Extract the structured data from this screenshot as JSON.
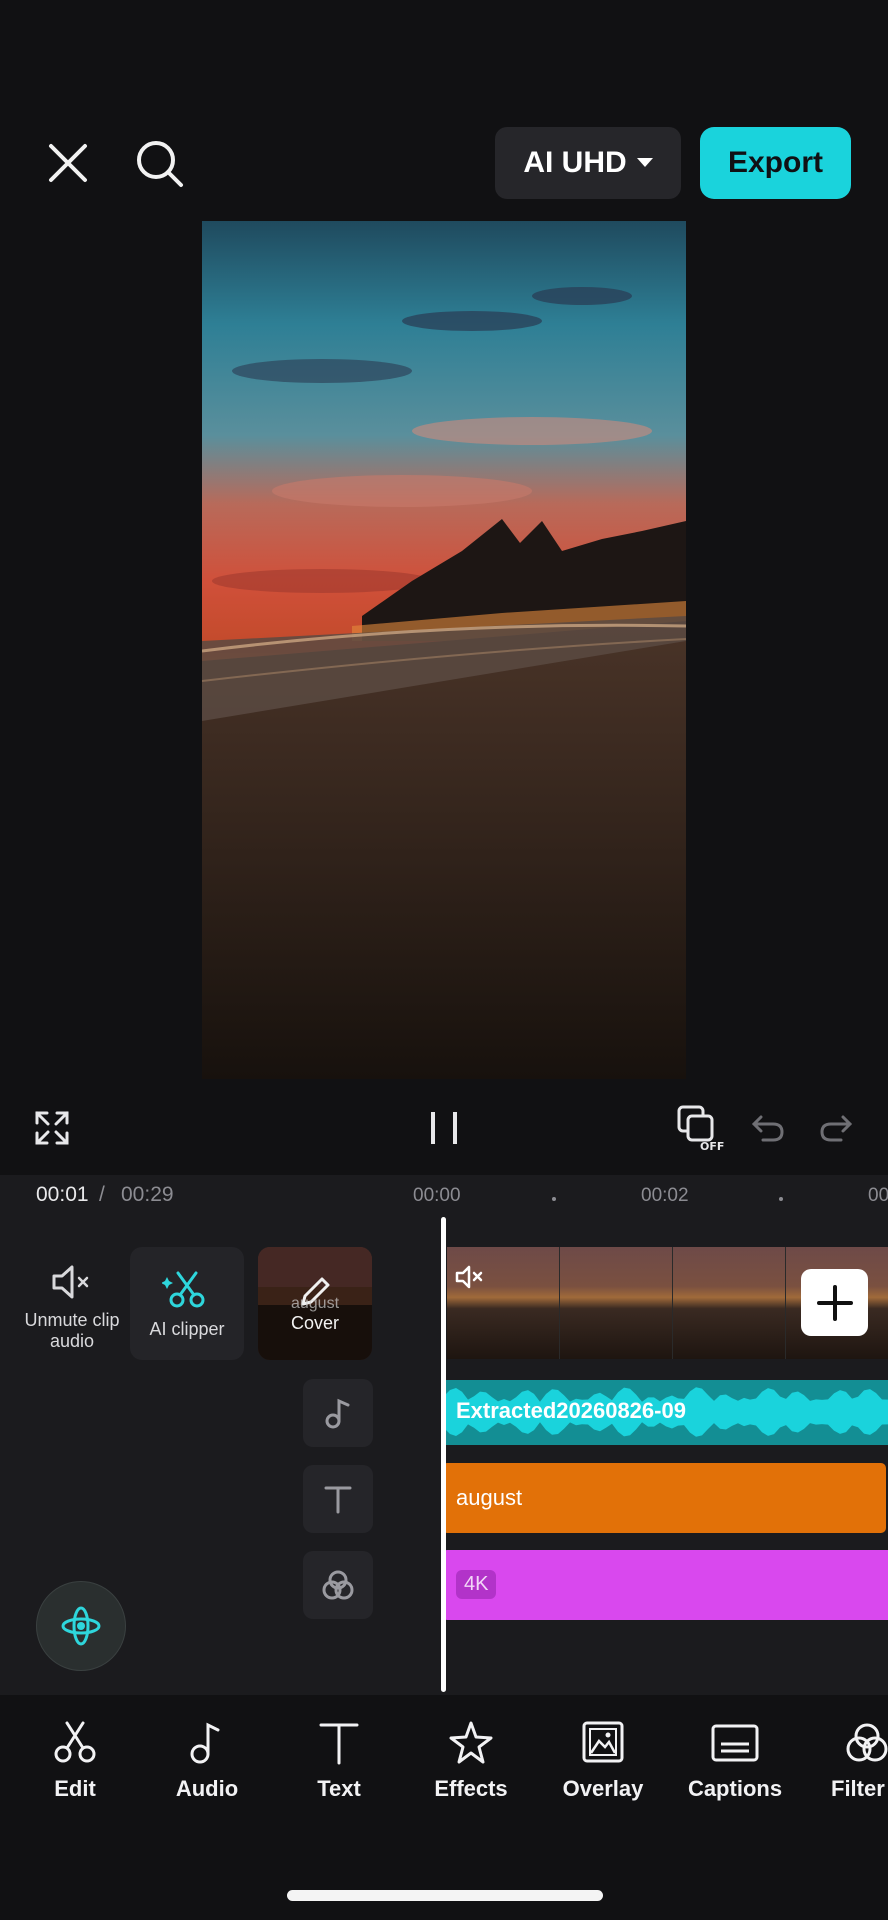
{
  "topbar": {
    "quality_label": "AI UHD",
    "export_label": "Export"
  },
  "player": {
    "current_time": "00:01",
    "separator": "/",
    "total_time": "00:29",
    "ticks": [
      "00:00",
      "00:02",
      "00"
    ]
  },
  "side": {
    "unmute_label": "Unmute clip audio",
    "ai_clipper_label": "AI clipper",
    "cover_title": "august",
    "cover_label": "Cover"
  },
  "tracks": {
    "audio_name": "Extracted20260826-09",
    "text_name": "august",
    "filter_badge": "4K"
  },
  "toolbar": {
    "items": [
      {
        "label": "Edit",
        "icon": "scissors-icon"
      },
      {
        "label": "Audio",
        "icon": "music-note-icon"
      },
      {
        "label": "Text",
        "icon": "text-icon"
      },
      {
        "label": "Effects",
        "icon": "star-icon"
      },
      {
        "label": "Overlay",
        "icon": "overlay-icon"
      },
      {
        "label": "Captions",
        "icon": "captions-icon"
      },
      {
        "label": "Filter",
        "icon": "filter-icon"
      }
    ]
  },
  "colors": {
    "accent": "#1ad3dc",
    "audio_track": "#18c3c9",
    "text_track": "#e27108",
    "filter_track": "#d948ee"
  }
}
